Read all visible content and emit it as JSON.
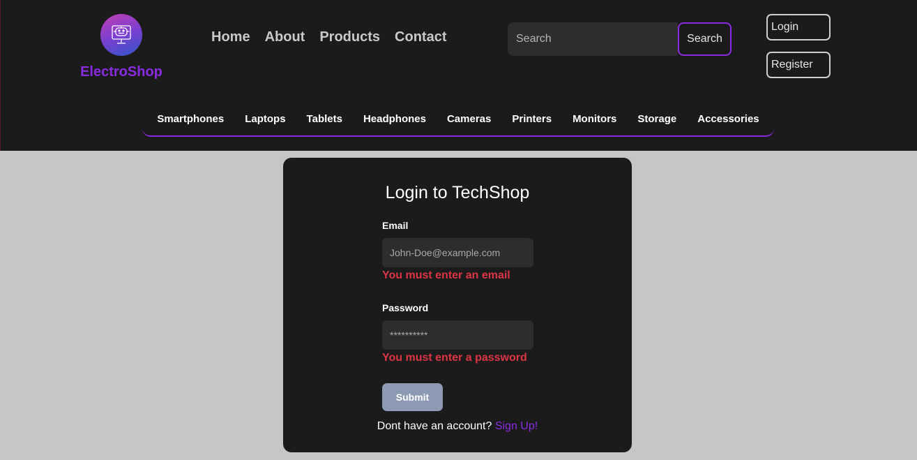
{
  "brand": {
    "name": "ElectroShop",
    "logo_icon": "monitor-robot-icon",
    "accent": "#8a2be2"
  },
  "nav": [
    {
      "label": "Home"
    },
    {
      "label": "About"
    },
    {
      "label": "Products"
    },
    {
      "label": "Contact"
    }
  ],
  "search": {
    "placeholder": "Search",
    "button": "Search"
  },
  "auth": {
    "login": "Login",
    "register": "Register"
  },
  "categories": [
    {
      "label": "Smartphones"
    },
    {
      "label": "Laptops"
    },
    {
      "label": "Tablets"
    },
    {
      "label": "Headphones"
    },
    {
      "label": "Cameras"
    },
    {
      "label": "Printers"
    },
    {
      "label": "Monitors"
    },
    {
      "label": "Storage"
    },
    {
      "label": "Accessories"
    }
  ],
  "login_form": {
    "title": "Login to TechShop",
    "email_label": "Email",
    "email_placeholder": "John-Doe@example.com",
    "email_error": "You must enter an email",
    "password_label": "Password",
    "password_placeholder": "**********",
    "password_error": "You must enter a password",
    "submit": "Submit",
    "signup_prompt": "Dont have an account? ",
    "signup_link": "Sign Up!",
    "error_color": "#dc3545"
  }
}
